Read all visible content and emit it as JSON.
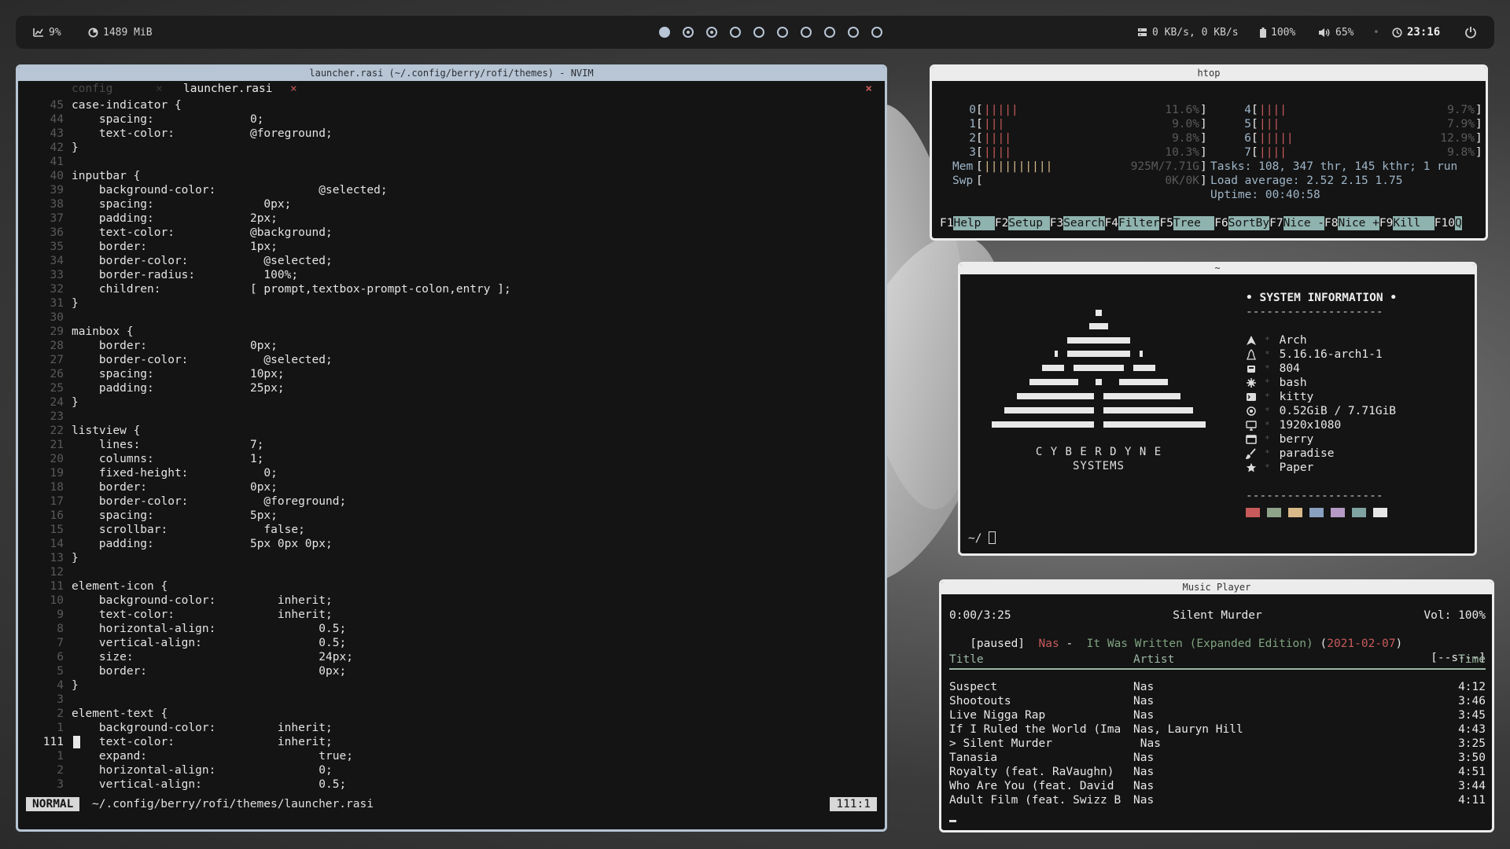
{
  "statusbar": {
    "cpu": "9%",
    "mem": "1489 MiB",
    "workspaces": [
      "active",
      "occupied",
      "occupied",
      "empty",
      "empty",
      "empty",
      "empty",
      "empty",
      "empty",
      "empty"
    ],
    "net": "0 KB/s, 0 KB/s",
    "battery": "100%",
    "volume": "65%",
    "time": "23:16",
    "icons": [
      "chart-icon",
      "memory-icon",
      "network-icon",
      "battery-icon",
      "volume-icon",
      "clock-icon",
      "power-icon"
    ]
  },
  "nvim": {
    "title": "launcher.rasi (~/.config/berry/rofi/themes) - NVIM",
    "tabs": [
      {
        "label": "config",
        "close": "×"
      },
      {
        "label": "launcher.rasi",
        "close": "×"
      }
    ],
    "close": "×",
    "lines": [
      {
        "n": "45",
        "t": "case-indicator {"
      },
      {
        "n": "44",
        "t": "    spacing:              0;"
      },
      {
        "n": "43",
        "t": "    text-color:           @foreground;"
      },
      {
        "n": "42",
        "t": "}"
      },
      {
        "n": "41",
        "t": ""
      },
      {
        "n": "40",
        "t": "inputbar {"
      },
      {
        "n": "39",
        "t": "    background-color:               @selected;"
      },
      {
        "n": "38",
        "t": "    spacing:                0px;"
      },
      {
        "n": "37",
        "t": "    padding:              2px;"
      },
      {
        "n": "36",
        "t": "    text-color:           @background;"
      },
      {
        "n": "35",
        "t": "    border:               1px;"
      },
      {
        "n": "34",
        "t": "    border-color:           @selected;"
      },
      {
        "n": "33",
        "t": "    border-radius:          100%;"
      },
      {
        "n": "32",
        "t": "    children:             [ prompt,textbox-prompt-colon,entry ];"
      },
      {
        "n": "31",
        "t": "}"
      },
      {
        "n": "30",
        "t": ""
      },
      {
        "n": "29",
        "t": "mainbox {"
      },
      {
        "n": "28",
        "t": "    border:               0px;"
      },
      {
        "n": "27",
        "t": "    border-color:           @selected;"
      },
      {
        "n": "26",
        "t": "    spacing:              10px;"
      },
      {
        "n": "25",
        "t": "    padding:              25px;"
      },
      {
        "n": "24",
        "t": "}"
      },
      {
        "n": "23",
        "t": ""
      },
      {
        "n": "22",
        "t": "listview {"
      },
      {
        "n": "21",
        "t": "    lines:                7;"
      },
      {
        "n": "20",
        "t": "    columns:              1;"
      },
      {
        "n": "19",
        "t": "    fixed-height:           0;"
      },
      {
        "n": "18",
        "t": "    border:               0px;"
      },
      {
        "n": "17",
        "t": "    border-color:           @foreground;"
      },
      {
        "n": "16",
        "t": "    spacing:              5px;"
      },
      {
        "n": "15",
        "t": "    scrollbar:              false;"
      },
      {
        "n": "14",
        "t": "    padding:              5px 0px 0px;"
      },
      {
        "n": "13",
        "t": "}"
      },
      {
        "n": "12",
        "t": ""
      },
      {
        "n": "11",
        "t": "element-icon {"
      },
      {
        "n": "10",
        "t": "    background-color:         inherit;"
      },
      {
        "n": "9",
        "t": "    text-color:               inherit;"
      },
      {
        "n": "8",
        "t": "    horizontal-align:               0.5;"
      },
      {
        "n": "7",
        "t": "    vertical-align:                 0.5;"
      },
      {
        "n": "6",
        "t": "    size:                           24px;"
      },
      {
        "n": "5",
        "t": "    border:                         0px;"
      },
      {
        "n": "4",
        "t": "}"
      },
      {
        "n": "3",
        "t": ""
      },
      {
        "n": "2",
        "t": "element-text {"
      },
      {
        "n": "1",
        "t": "    background-color:         inherit;"
      },
      {
        "n": "111",
        "t": "    text-color:               inherit;",
        "current": true
      },
      {
        "n": "1",
        "t": "    expand:                         true;"
      },
      {
        "n": "2",
        "t": "    horizontal-align:               0;"
      },
      {
        "n": "3",
        "t": "    vertical-align:                 0.5;"
      }
    ],
    "mode": "NORMAL",
    "path": "~/.config/berry/rofi/themes/launcher.rasi",
    "pos": "111:1"
  },
  "htop": {
    "title": "htop",
    "cpus": [
      {
        "id": "0",
        "bars": "|||||",
        "pct": "11.6%"
      },
      {
        "id": "1",
        "bars": "|||",
        "pct": "9.0%"
      },
      {
        "id": "2",
        "bars": "||||",
        "pct": "9.8%"
      },
      {
        "id": "3",
        "bars": "||||",
        "pct": "10.3%"
      },
      {
        "id": "4",
        "bars": "||||",
        "pct": "9.7%"
      },
      {
        "id": "5",
        "bars": "|||",
        "pct": "7.9%"
      },
      {
        "id": "6",
        "bars": "|||||",
        "pct": "12.9%"
      },
      {
        "id": "7",
        "bars": "||||",
        "pct": "9.8%"
      }
    ],
    "mem_label": "Mem",
    "mem_bars": "||||||||||",
    "mem_val": "925M/7.71G",
    "swp_label": "Swp",
    "swp_val": "0K/0K",
    "tasks": "Tasks: 108, 347 thr, 145 kthr; 1 run",
    "load": "Load average: 2.52 2.15 1.75",
    "uptime": "Uptime: 00:40:58",
    "fkeys": [
      [
        "F1",
        "Help  "
      ],
      [
        "F2",
        "Setup "
      ],
      [
        "F3",
        "Search"
      ],
      [
        "F4",
        "Filter"
      ],
      [
        "F5",
        "Tree  "
      ],
      [
        "F6",
        "SortBy"
      ],
      [
        "F7",
        "Nice -"
      ],
      [
        "F8",
        "Nice +"
      ],
      [
        "F9",
        "Kill  "
      ],
      [
        "F10",
        "Q"
      ]
    ]
  },
  "fetch": {
    "title": "~",
    "logo1": "C Y B E R D Y N E",
    "logo2": "SYSTEMS",
    "heading": "• SYSTEM INFORMATION •",
    "rule": "--------------------",
    "rows": [
      {
        "icon": "arch-icon",
        "val": "Arch"
      },
      {
        "icon": "linux-icon",
        "val": "5.16.16-arch1-1"
      },
      {
        "icon": "package-icon",
        "val": "804"
      },
      {
        "icon": "shell-icon",
        "val": "bash"
      },
      {
        "icon": "terminal-icon",
        "val": "kitty"
      },
      {
        "icon": "memory-icon",
        "val": "0.52GiB / 7.71GiB"
      },
      {
        "icon": "monitor-icon",
        "val": "1920x1080"
      },
      {
        "icon": "window-icon",
        "val": "berry"
      },
      {
        "icon": "brush-icon",
        "val": "paradise"
      },
      {
        "icon": "star-icon",
        "val": "Paper"
      }
    ],
    "palette": [
      "#c75a5a",
      "#8fa38a",
      "#d9b98a",
      "#8aa0c0",
      "#b49ac4",
      "#7fa3a0",
      "#e6e6e6"
    ],
    "prompt": "~/"
  },
  "music": {
    "title": "Music Player",
    "time": "0:00/3:25",
    "now": "Silent Murder",
    "vol": "Vol: 100%",
    "state": "[paused]",
    "artist": "Nas",
    "sep": "-",
    "album": "It Was Written (Expanded Edition)",
    "date": "2021-02-07",
    "flags": "[--s---]",
    "cols": [
      "Title",
      "Artist",
      "Time"
    ],
    "tracks": [
      {
        "t": "Suspect",
        "a": "Nas",
        "d": "4:12"
      },
      {
        "t": "Shootouts",
        "a": "Nas",
        "d": "3:46"
      },
      {
        "t": "Live Nigga Rap",
        "a": "Nas",
        "d": "3:45"
      },
      {
        "t": "If I Ruled the World (Ima",
        "a": "Nas, Lauryn Hill",
        "d": "4:43"
      },
      {
        "t": "> Silent Murder",
        "a": " Nas",
        "d": "3:25"
      },
      {
        "t": "Tanasia",
        "a": "Nas",
        "d": "3:50"
      },
      {
        "t": "Royalty (feat. RaVaughn)",
        "a": "Nas",
        "d": "4:51"
      },
      {
        "t": "Who Are You (feat. David",
        "a": "Nas",
        "d": "3:44"
      },
      {
        "t": "Adult Film (feat. Swizz B",
        "a": "Nas",
        "d": "4:11"
      }
    ]
  }
}
